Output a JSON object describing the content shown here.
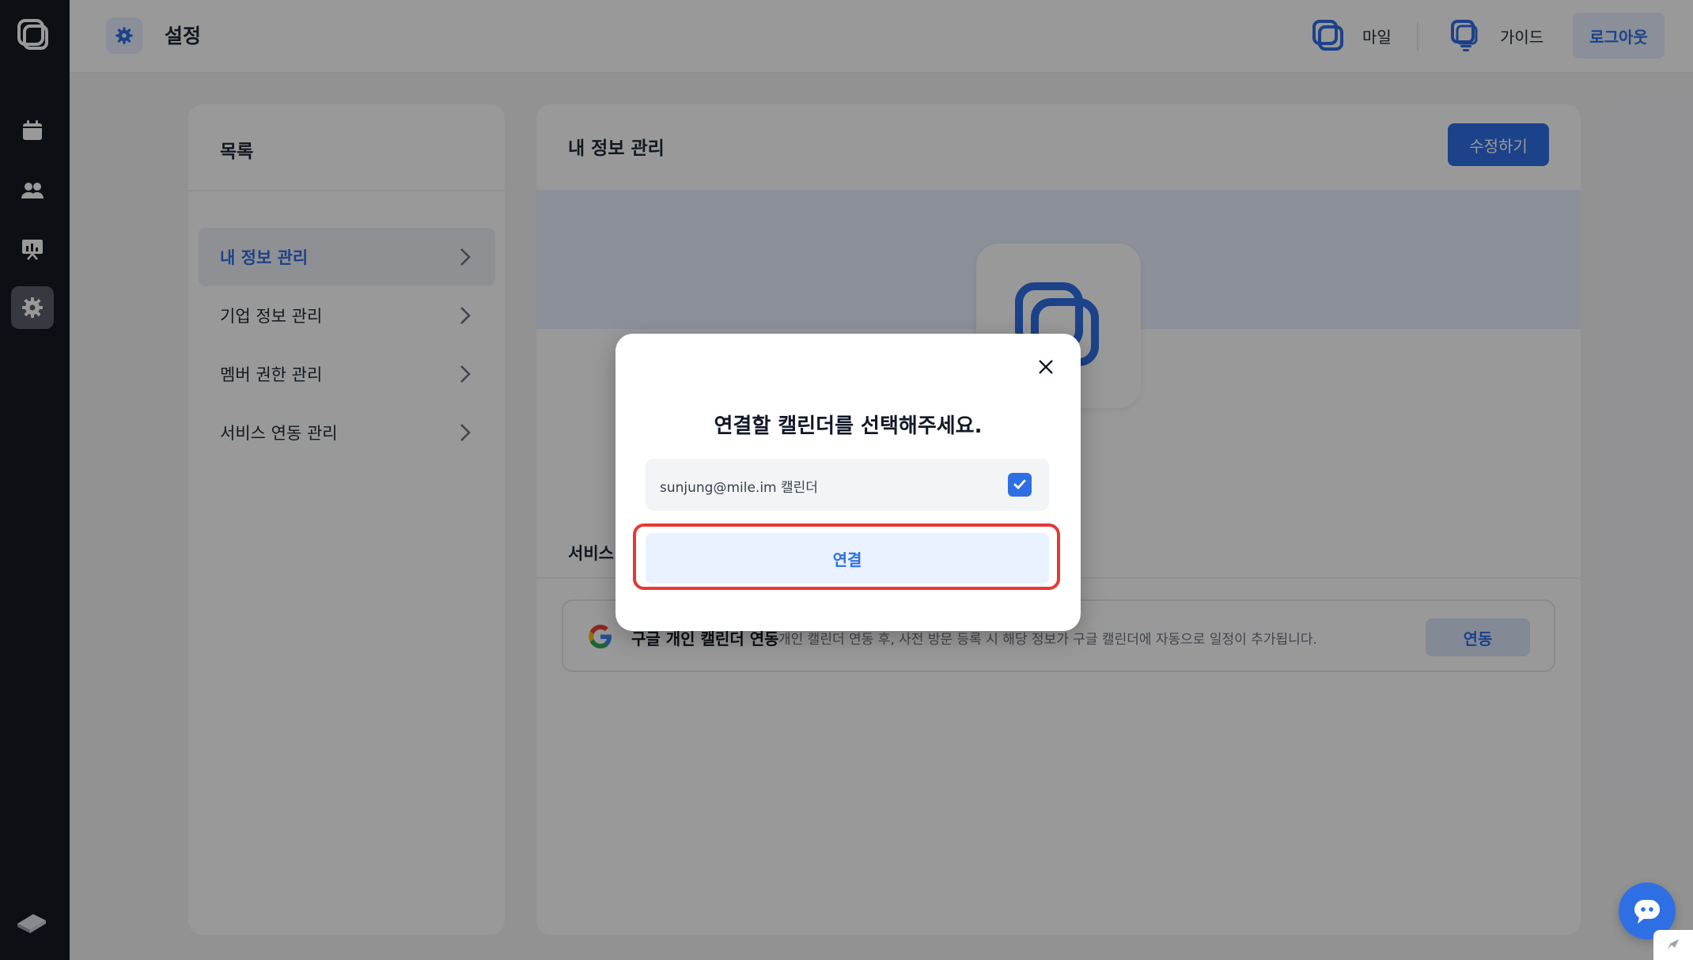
{
  "header": {
    "title": "설정",
    "links": [
      {
        "label": "마일",
        "icon": "mile-logo-icon"
      },
      {
        "label": "가이드",
        "icon": "guide-icon"
      }
    ],
    "logout_label": "로그아웃"
  },
  "rail": {
    "items": [
      {
        "icon": "calendar-icon",
        "active": false
      },
      {
        "icon": "users-icon",
        "active": false
      },
      {
        "icon": "presentation-icon",
        "active": false
      },
      {
        "icon": "settings-gear-icon",
        "active": true
      }
    ],
    "bottom_icon": "book-icon"
  },
  "list_panel": {
    "title": "목록",
    "items": [
      {
        "label": "내 정보 관리",
        "active": true
      },
      {
        "label": "기업 정보 관리",
        "active": false
      },
      {
        "label": "멤버 권한 관리",
        "active": false
      },
      {
        "label": "서비스 연동 관리",
        "active": false
      }
    ]
  },
  "main_panel": {
    "title": "내 정보 관리",
    "edit_label": "수정하기",
    "section_label": "서비스",
    "service": {
      "name": "구글 개인 캘린더 연동",
      "description": "개인 캘린더 연동 후, 사전 방문 등록 시 해당 정보가 구글 캘린더에 자동으로 일정이 추가됩니다.",
      "button_label": "연동"
    }
  },
  "modal": {
    "heading": "연결할 캘린더를 선택해주세요.",
    "option_label": "sunjung@mile.im 캘린더",
    "option_checked": true,
    "connect_label": "연결"
  },
  "colors": {
    "accent": "#2f6fe4",
    "rail_bg": "#151a21",
    "highlight": "#e53935"
  }
}
